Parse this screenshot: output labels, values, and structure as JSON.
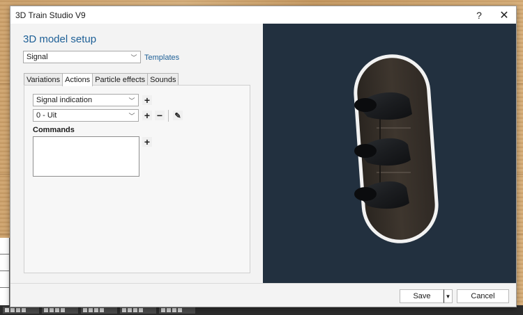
{
  "window": {
    "title": "3D Train Studio V9",
    "help_glyph": "?",
    "close_glyph": "✕"
  },
  "setup": {
    "heading": "3D model setup",
    "model_type": {
      "value": "Signal"
    },
    "templates_link": "Templates"
  },
  "tabs": [
    {
      "label": "Variations",
      "active": false
    },
    {
      "label": "Actions",
      "active": true
    },
    {
      "label": "Particle effects",
      "active": false
    },
    {
      "label": "Sounds",
      "active": false
    }
  ],
  "actions_tab": {
    "action_select": {
      "value": "Signal indication"
    },
    "state_select": {
      "value": "0 - Uit"
    },
    "commands_label": "Commands",
    "plus_glyph": "+",
    "minus_glyph": "−",
    "edit_glyph": "✎"
  },
  "footer": {
    "save_label": "Save",
    "save_dropdown_glyph": "▼",
    "cancel_label": "Cancel"
  },
  "colors": {
    "accent": "#1d5f96",
    "viewport_bg": "#22303f"
  }
}
